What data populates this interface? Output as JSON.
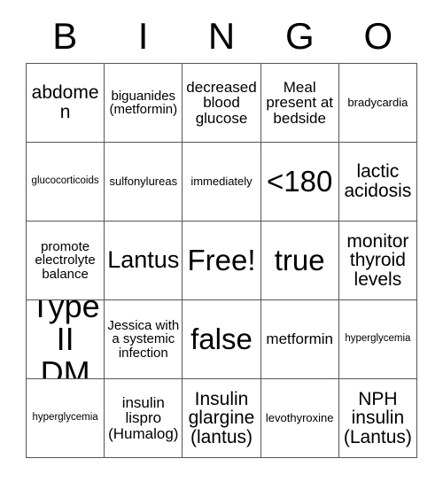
{
  "header": {
    "letters": [
      "B",
      "I",
      "N",
      "G",
      "O"
    ]
  },
  "grid": {
    "rows": [
      [
        {
          "text": "abdomen",
          "size": "lg"
        },
        {
          "text": "biguanides (metformin)",
          "size": "sm"
        },
        {
          "text": "decreased blood glucose",
          "size": "md"
        },
        {
          "text": "Meal present at bedside",
          "size": "md"
        },
        {
          "text": "bradycardia",
          "size": "xs"
        }
      ],
      [
        {
          "text": "glucocorticoids",
          "size": "xxs"
        },
        {
          "text": "sulfonylureas",
          "size": "xs"
        },
        {
          "text": "immediately",
          "size": "xs"
        },
        {
          "text": "<180",
          "size": "xxl"
        },
        {
          "text": "lactic acidosis",
          "size": "lg"
        }
      ],
      [
        {
          "text": "promote electrolyte balance",
          "size": "sm"
        },
        {
          "text": "Lantus",
          "size": "xl"
        },
        {
          "text": "Free!",
          "size": "xxl"
        },
        {
          "text": "true",
          "size": "xxl"
        },
        {
          "text": "monitor thyroid levels",
          "size": "lg"
        }
      ],
      [
        {
          "text": "Type II DM",
          "size": "huge"
        },
        {
          "text": "Jessica with a systemic infection",
          "size": "sm"
        },
        {
          "text": "false",
          "size": "xxl"
        },
        {
          "text": "metformin",
          "size": "md"
        },
        {
          "text": "hyperglycemia",
          "size": "xxs"
        }
      ],
      [
        {
          "text": "hyperglycemia",
          "size": "xxs"
        },
        {
          "text": "insulin lispro (Humalog)",
          "size": "md"
        },
        {
          "text": "Insulin glargine (lantus)",
          "size": "lg"
        },
        {
          "text": "levothyroxine",
          "size": "xs"
        },
        {
          "text": "NPH insulin (Lantus)",
          "size": "lg"
        }
      ]
    ]
  },
  "colors": {
    "grid_line": "#555555",
    "text": "#000000",
    "background": "#ffffff"
  }
}
